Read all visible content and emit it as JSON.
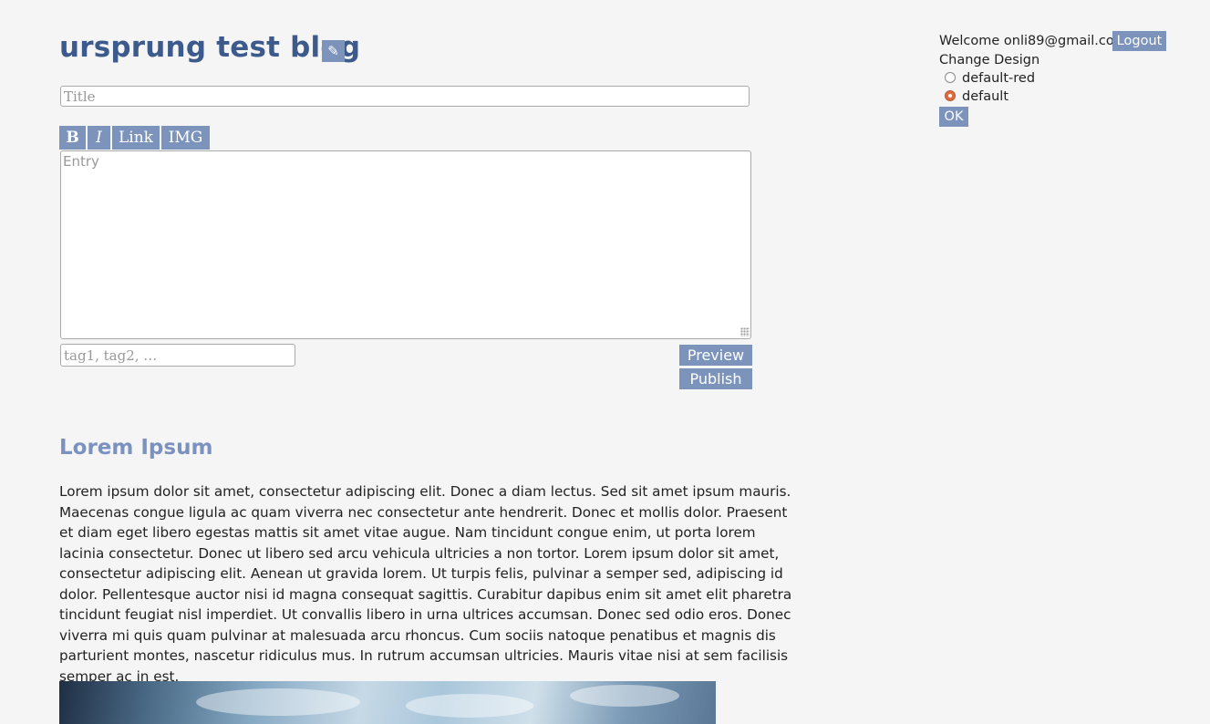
{
  "blog": {
    "title": "ursprung test blog",
    "edit_icon": "pencil-icon",
    "edit_glyph": "✎"
  },
  "editor": {
    "title_placeholder": "Title",
    "toolbar": {
      "bold": "B",
      "italic": "I",
      "link": "Link",
      "img": "IMG"
    },
    "entry_placeholder": "Entry",
    "tags_placeholder": "tag1, tag2, …",
    "preview_label": "Preview",
    "publish_label": "Publish"
  },
  "post": {
    "title": "Lorem Ipsum",
    "body": "Lorem ipsum dolor sit amet, consectetur adipiscing elit. Donec a diam lectus. Sed sit amet ipsum mauris. Maecenas congue ligula ac quam viverra nec consectetur ante hendrerit. Donec et mollis dolor. Praesent et diam eget libero egestas mattis sit amet vitae augue. Nam tincidunt congue enim, ut porta lorem lacinia consectetur. Donec ut libero sed arcu vehicula ultricies a non tortor. Lorem ipsum dolor sit amet, consectetur adipiscing elit. Aenean ut gravida lorem. Ut turpis felis, pulvinar a semper sed, adipiscing id dolor. Pellentesque auctor nisi id magna consequat sagittis. Curabitur dapibus enim sit amet elit pharetra tincidunt feugiat nisl imperdiet. Ut convallis libero in urna ultrices accumsan. Donec sed odio eros. Donec viverra mi quis quam pulvinar at malesuada arcu rhoncus. Cum sociis natoque penatibus et magnis dis parturient montes, nascetur ridiculus mus. In rutrum accumsan ultricies. Mauris vitae nisi at sem facilisis semper ac in est."
  },
  "sidebar": {
    "welcome": "Welcome onli89@gmail.com",
    "logout_label": "Logout",
    "change_design_label": "Change Design",
    "designs": [
      {
        "label": "default-red",
        "selected": false
      },
      {
        "label": "default",
        "selected": true
      }
    ],
    "ok_label": "OK"
  },
  "colors": {
    "background": "#f5f5f5",
    "button": "#7c94bb",
    "blog_title": "#3d5a8c",
    "post_title": "#7b92be",
    "radio_selected": "#e46a3a"
  }
}
